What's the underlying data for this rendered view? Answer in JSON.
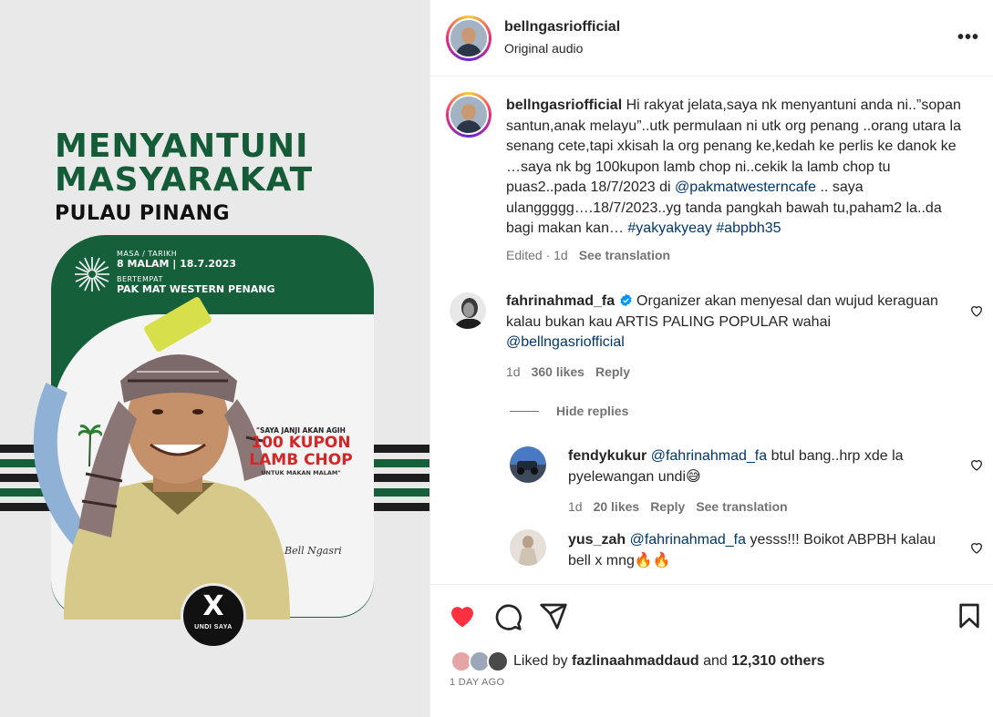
{
  "poster": {
    "title_line1": "MENYANTUNI",
    "title_line2": "MASYARAKAT",
    "subtitle": "PULAU PINANG",
    "time_label": "MASA / TARIKH",
    "time_value": "8 MALAM | 18.7.2023",
    "venue_label": "BERTEMPAT",
    "venue_value": "PAK MAT WESTERN PENANG",
    "quote_line1": "\"SAYA JANJI AKAN AGIH",
    "quote_line2": "100 KUPON",
    "quote_line3": "LAMB CHOP",
    "quote_line4": "UNTUK MAKAN MALAM\"",
    "signature": "Bell Ngasri",
    "vote_mark": "X",
    "vote_label": "UNDI SAYA"
  },
  "header": {
    "username": "bellngasriofficial",
    "audio": "Original audio"
  },
  "caption": {
    "username": "bellngasriofficial",
    "text_before_mention": "Hi rakyat jelata,saya nk menyantuni anda ni..”sopan santun,anak melayu”..utk permulaan ni utk org penang ..orang utara la senang cete,tapi xkisah la org penang ke,kedah ke perlis ke danok ke …saya nk bg 100kupon lamb chop ni..cekik la lamb chop tu puas2..pada 18/7/2023 di ",
    "mention": "@pakmatwesterncafe",
    "text_after_mention": " .. saya ulanggggg….18/7/2023..yg tanda pangkah bawah tu,paham2 la..da bagi makan kan… ",
    "hashtag1": "#yakyakyeay",
    "hashtag2": "#abpbh35",
    "edited": "Edited · 1d",
    "see_translation": "See translation"
  },
  "comment1": {
    "username": "fahrinahmad_fa",
    "text": "Organizer akan menyesal dan wujud keraguan kalau bukan kau ARTIS PALING POPULAR wahai ",
    "mention": "@bellngasriofficial",
    "time": "1d",
    "likes": "360 likes",
    "reply": "Reply",
    "hide_replies": "Hide replies"
  },
  "reply1": {
    "username": "fendykukur",
    "mention": "@fahrinahmad_fa",
    "text": " btul bang..hrp xde la pyelewangan undi😅",
    "time": "1d",
    "likes": "20 likes",
    "reply": "Reply",
    "see_translation": "See translation"
  },
  "reply2": {
    "username": "yus_zah",
    "mention": "@fahrinahmad_fa",
    "text": " yesss!!! Boikot ABPBH kalau bell x mng🔥🔥"
  },
  "likes": {
    "prefix": "Liked by ",
    "user": "fazlinaahmaddaud",
    "middle": " and ",
    "count": "12,310 others",
    "time_ago": "1 DAY AGO"
  },
  "colors": {
    "heart_red": "#ff3040",
    "link_blue": "#00376b",
    "verified_blue": "#0095f6",
    "poster_green": "#15603a"
  },
  "icons": [
    "more-icon",
    "heart-icon",
    "comment-icon",
    "share-icon",
    "bookmark-icon",
    "verified-badge-icon",
    "sunburst-icon"
  ]
}
